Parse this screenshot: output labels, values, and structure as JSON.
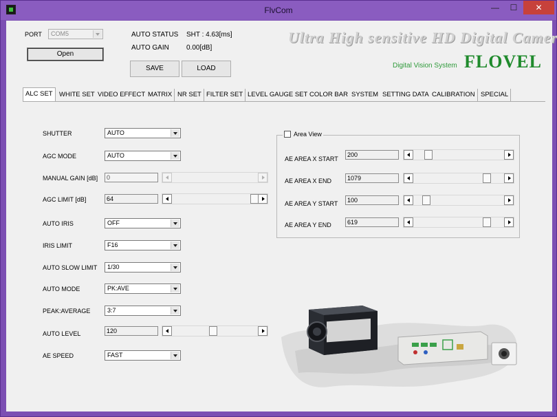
{
  "window": {
    "title": "FlvCom",
    "min": "—",
    "max": "☐",
    "close": "✕"
  },
  "top": {
    "port_label": "PORT",
    "port_value": "COM5",
    "open_button": "Open",
    "auto_status_label": "AUTO STATUS",
    "auto_status_value": "SHT : 4.63[ms]",
    "auto_gain_label": "AUTO GAIN",
    "auto_gain_value": "0.00[dB]",
    "save_button": "SAVE",
    "load_button": "LOAD"
  },
  "banner": {
    "title": "Ultra High sensitive HD Digital Camera",
    "tagline": "Digital Vision System",
    "brand": "FLOVEL"
  },
  "tabs": [
    "ALC SET",
    "WHITE SET",
    "VIDEO EFFECT",
    "MATRIX",
    "NR SET",
    "FILTER SET",
    "LEVEL GAUGE SET",
    "COLOR BAR",
    "SYSTEM",
    "SETTING DATA",
    "CALIBRATION",
    "SPECIAL"
  ],
  "alc": {
    "shutter": {
      "label": "SHUTTER",
      "value": "AUTO"
    },
    "agc_mode": {
      "label": "AGC MODE",
      "value": "AUTO"
    },
    "manual_gain": {
      "label": "MANUAL GAIN [dB]",
      "value": "0",
      "level": 0
    },
    "agc_limit": {
      "label": "AGC LIMIT [dB]",
      "value": "64",
      "level": 1.0
    },
    "auto_iris": {
      "label": "AUTO IRIS",
      "value": "OFF"
    },
    "iris_limit": {
      "label": "IRIS LIMIT",
      "value": "F16"
    },
    "auto_slow_limit": {
      "label": "AUTO SLOW LIMIT",
      "value": "1/30"
    },
    "auto_mode": {
      "label": "AUTO MODE",
      "value": "PK:AVE"
    },
    "peak_average": {
      "label": "PEAK:AVERAGE",
      "value": "3:7"
    },
    "auto_level": {
      "label": "AUTO LEVEL",
      "value": "120",
      "level": 0.47
    },
    "ae_speed": {
      "label": "AE SPEED",
      "value": "FAST"
    }
  },
  "area_view": {
    "title": "Area View",
    "x_start": {
      "label": "AE AREA X START",
      "value": "200",
      "level": 0.19
    },
    "x_end": {
      "label": "AE AREA X END",
      "value": "1079",
      "level": 0.97
    },
    "y_start": {
      "label": "AE AREA Y START",
      "value": "100",
      "level": 0.16
    },
    "y_end": {
      "label": "AE AREA Y END",
      "value": "619",
      "level": 0.97
    }
  }
}
